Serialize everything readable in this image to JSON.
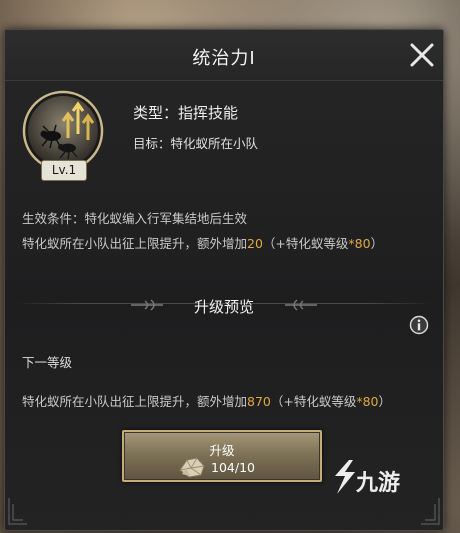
{
  "dialog": {
    "title": "统治力I",
    "skill": {
      "level_badge": "Lv.1",
      "type_text": "类型：指挥技能",
      "target_text": "目标：特化蚁所在小队"
    },
    "effect_condition": "生效条件：特化蚁编入行军集结地后生效",
    "current_effect": {
      "prefix": "特化蚁所在小队出征上限提升，额外增加",
      "value": "20",
      "suffix_start": "（+特化蚁等级",
      "multiplier": "*80",
      "suffix_end": "）"
    },
    "upgrade_preview": {
      "section_title": "升级预览",
      "next_level_label": "下一等级",
      "next_effect": {
        "prefix": "特化蚁所在小队出征上限提升，额外增加",
        "value": "870",
        "suffix_start": "（+特化蚁等级",
        "multiplier": "*80",
        "suffix_end": "）"
      }
    },
    "upgrade_button": {
      "label": "升级",
      "cost": "104/10"
    }
  },
  "watermark": {
    "text": "九游"
  },
  "colors": {
    "highlight": "#e0a843",
    "button_border": "#c4ad7a"
  }
}
